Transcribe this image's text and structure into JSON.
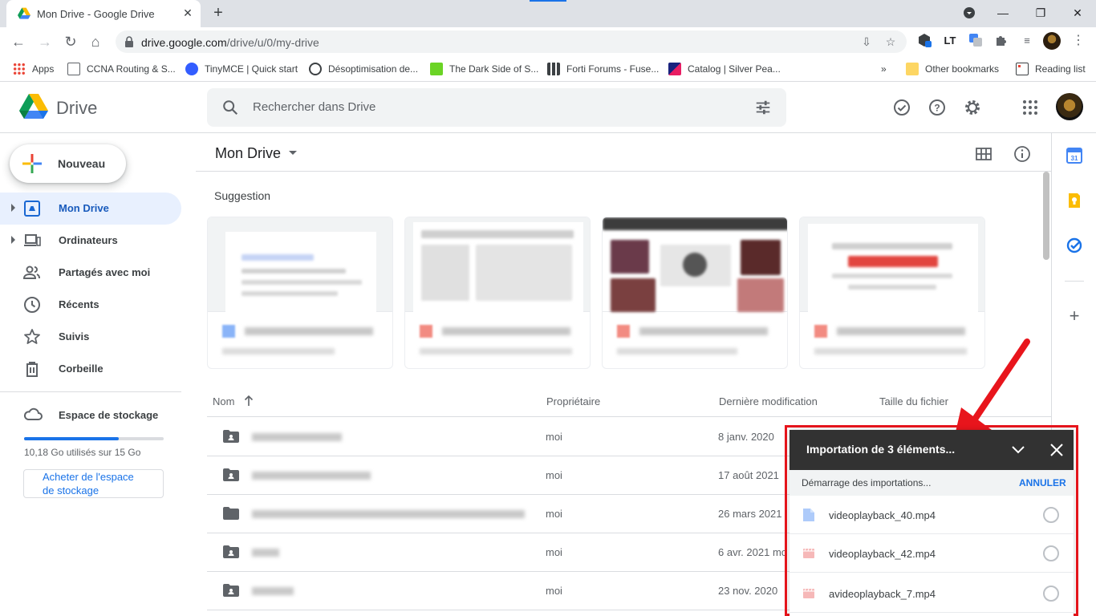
{
  "browser": {
    "tab_title": "Mon Drive - Google Drive",
    "url_host": "drive.google.com",
    "url_path": "/drive/u/0/my-drive",
    "bookmarks": [
      {
        "label": "Apps"
      },
      {
        "label": "CCNA Routing & S..."
      },
      {
        "label": "TinyMCE | Quick start"
      },
      {
        "label": "Désoptimisation de..."
      },
      {
        "label": "The Dark Side of S..."
      },
      {
        "label": "Forti Forums - Fuse..."
      },
      {
        "label": "Catalog | Silver Pea..."
      }
    ],
    "bookmarks_overflow": "»",
    "other_bookmarks": "Other bookmarks",
    "reading_list": "Reading list"
  },
  "header": {
    "app_name": "Drive",
    "search_placeholder": "Rechercher dans Drive"
  },
  "sidebar": {
    "new_label": "Nouveau",
    "items": [
      {
        "label": "Mon Drive"
      },
      {
        "label": "Ordinateurs"
      },
      {
        "label": "Partagés avec moi"
      },
      {
        "label": "Récents"
      },
      {
        "label": "Suivis"
      },
      {
        "label": "Corbeille"
      }
    ],
    "storage_title": "Espace de stockage",
    "storage_used_text": "10,18 Go utilisés sur 15 Go",
    "storage_used_fraction": 0.679,
    "buy_label": "Acheter de l'espace de stockage"
  },
  "main": {
    "title": "Mon Drive",
    "suggestion_title": "Suggestion",
    "columns": {
      "name": "Nom",
      "owner": "Propriétaire",
      "modified": "Dernière modification",
      "size": "Taille du fichier"
    },
    "rows": [
      {
        "owner": "moi",
        "modified": "8 janv. 2020"
      },
      {
        "owner": "moi",
        "modified": "17 août 2021"
      },
      {
        "owner": "moi",
        "modified": "26 mars 2021"
      },
      {
        "owner": "moi",
        "modified": "6 avr. 2021",
        "modified_suffix": "mo"
      },
      {
        "owner": "moi",
        "modified": "23 nov. 2020"
      }
    ]
  },
  "upload": {
    "title": "Importation de 3 éléments...",
    "status": "Démarrage des importations...",
    "cancel_label": "ANNULER",
    "files": [
      {
        "name": "videoplayback_40.mp4",
        "icon": "doc-icon",
        "color": "#aecbfa"
      },
      {
        "name": "videoplayback_42.mp4",
        "icon": "video-icon",
        "color": "#f6b8b8"
      },
      {
        "name": "avideoplayback_7.mp4",
        "icon": "video-icon",
        "color": "#f6b8b8"
      }
    ]
  },
  "colors": {
    "accent": "#1a73e8",
    "active_nav_bg": "#e8f0fe",
    "highlight_red": "#e8151c"
  }
}
